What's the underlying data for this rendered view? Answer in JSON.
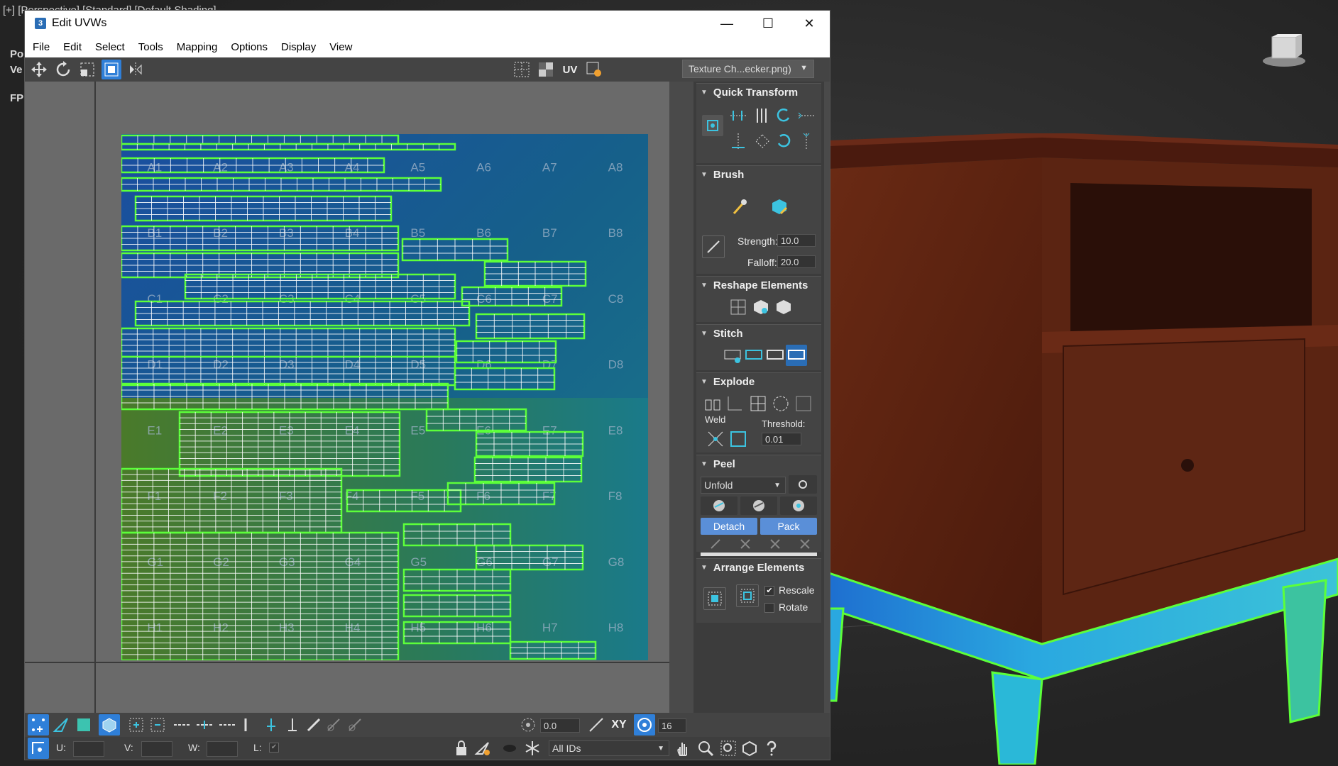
{
  "viewport": {
    "label": "[+] [Perspective] [Standard] [Default Shading]",
    "side_labels": [
      "Po",
      "Ve",
      "FP"
    ]
  },
  "dialog": {
    "app_icon_text": "3",
    "title": "Edit UVWs",
    "window_buttons": {
      "minimize": "—",
      "maximize": "☐",
      "close": "✕"
    },
    "menu": [
      "File",
      "Edit",
      "Select",
      "Tools",
      "Mapping",
      "Options",
      "Display",
      "View"
    ],
    "toolbar": {
      "uv_label": "UV",
      "texture_select": "Texture Ch...ecker.png)"
    },
    "texture_labels": [
      [
        "A1",
        "A2",
        "A3",
        "A4",
        "A5",
        "A6",
        "A7",
        "A8"
      ],
      [
        "B1",
        "B2",
        "B3",
        "B4",
        "B5",
        "B6",
        "B7",
        "B8"
      ],
      [
        "C1",
        "C2",
        "C3",
        "C4",
        "C5",
        "C6",
        "C7",
        "C8"
      ],
      [
        "D1",
        "D2",
        "D3",
        "D4",
        "D5",
        "D6",
        "D7",
        "D8"
      ],
      [
        "E1",
        "E2",
        "E3",
        "E4",
        "E5",
        "E6",
        "E7",
        "E8"
      ],
      [
        "F1",
        "F2",
        "F3",
        "F4",
        "F5",
        "F6",
        "F7",
        "F8"
      ],
      [
        "G1",
        "G2",
        "G3",
        "G4",
        "G5",
        "G6",
        "G7",
        "G8"
      ],
      [
        "H1",
        "H2",
        "H3",
        "H4",
        "H5",
        "H6",
        "H7",
        "H8"
      ]
    ],
    "panel": {
      "quick_transform": {
        "title": "Quick Transform"
      },
      "brush": {
        "title": "Brush",
        "strength_label": "Strength:",
        "strength_value": "10.0",
        "falloff_label": "Falloff:",
        "falloff_value": "20.0"
      },
      "reshape": {
        "title": "Reshape Elements"
      },
      "stitch": {
        "title": "Stitch"
      },
      "explode": {
        "title": "Explode",
        "weld_label": "Weld",
        "threshold_label": "Threshold:",
        "threshold_value": "0.01"
      },
      "peel": {
        "title": "Peel",
        "mode": "Unfold",
        "detach_label": "Detach",
        "pack_label": "Pack"
      },
      "arrange": {
        "title": "Arrange Elements",
        "rescale_label": "Rescale",
        "rescale_checked": true,
        "rotate_label": "Rotate",
        "rotate_checked": false
      }
    },
    "bottom": {
      "angle_value": "0.0",
      "xy_label": "XY",
      "snap_value": "16",
      "u_label": "U:",
      "v_label": "V:",
      "w_label": "W:",
      "l_label": "L:",
      "ids_select": "All IDs"
    }
  },
  "colors": {
    "uv_edge": "#5cff3a",
    "uv_fill": "#ffffff",
    "accent_blue": "#5a8fd8",
    "selected_blue": "#2f7fd8"
  }
}
